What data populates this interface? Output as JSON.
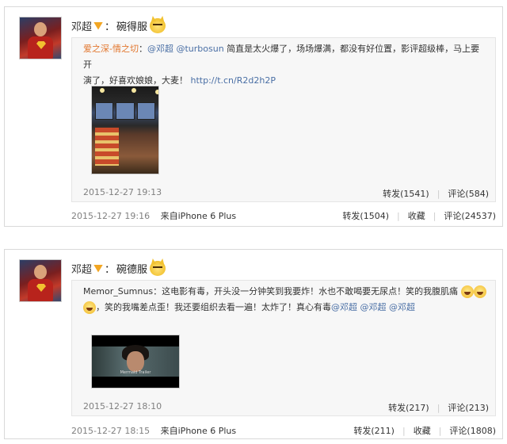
{
  "posts": [
    {
      "author": "邓超",
      "separator": "：",
      "text": "碗得服",
      "repost": {
        "handle": "爱之深-情之切",
        "lines": [
          {
            "parts": [
              {
                "t": "爱之深-情之切",
                "c": "handle"
              },
              {
                "t": "：",
                "c": "inline"
              },
              {
                "t": "@邓超",
                "c": "mention"
              },
              {
                "t": " ",
                "c": "inline"
              },
              {
                "t": "@turbosun",
                "c": "mention"
              },
              {
                "t": " 简直是太火爆了，场场爆满，都没有好位置，影评超级棒，马上要开",
                "c": "inline"
              }
            ]
          },
          {
            "parts": [
              {
                "t": "演了，好喜欢娘娘，大麦！ ",
                "c": "inline"
              },
              {
                "t": "http://t.cn/R2d2h2P",
                "c": "link"
              }
            ]
          }
        ],
        "time": "2015-12-27 19:13",
        "repost_label": "转发(1541)",
        "comment_label": "评论(584)"
      },
      "time": "2015-12-27 19:16",
      "source": "来自iPhone 6 Plus",
      "repost_label": "转发(1504)",
      "collect_label": "收藏",
      "comment_label": "评论(24537)"
    },
    {
      "author": "邓超",
      "separator": "：",
      "text": "碗德服",
      "repost": {
        "handle": "Memor_Sumnus",
        "line1": "Memor_Sumnus：这电影有毒，开头没一分钟笑到我要炸！水也不敢喝要无尿点！笑的我腹肌痛",
        "line2_text": "，笑的我嘴差点歪！我还要组织去看一遍！太炸了！真心有毒",
        "line2_mentions": "@邓超 @邓超 @邓超",
        "time": "2015-12-27 18:10",
        "repost_label": "转发(217)",
        "comment_label": "评论(213)",
        "video_caption": "Mermaid Trailer"
      },
      "time": "2015-12-27 18:15",
      "source": "来自iPhone 6 Plus",
      "repost_label": "转发(211)",
      "collect_label": "收藏",
      "comment_label": "评论(1808)"
    }
  ],
  "icons": {
    "vip_badge": "vip-crown-icon",
    "emoji": "cat-face-emoji",
    "laugh": "laugh-cry-emoji"
  },
  "colors": {
    "handle": "#e2762d",
    "mention": "#4a6fa5",
    "meta": "#808080",
    "repost_bg": "#f7f7f7"
  }
}
